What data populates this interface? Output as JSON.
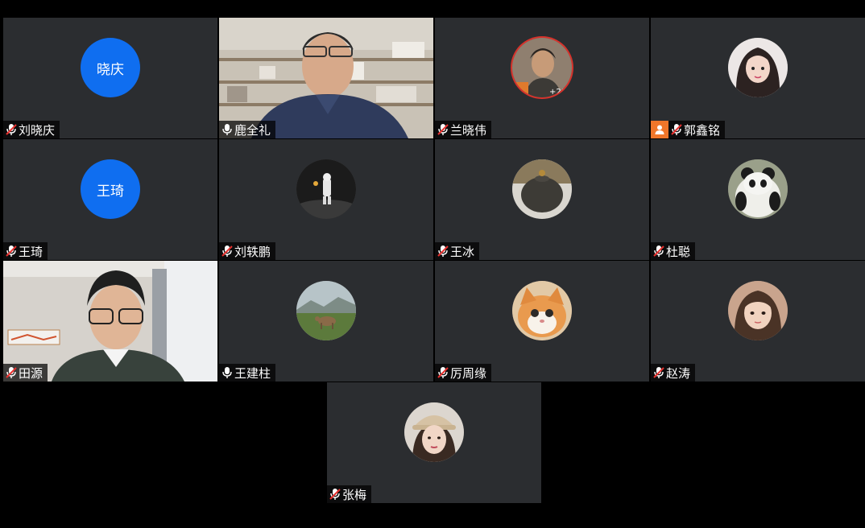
{
  "participants": [
    {
      "name": "刘晓庆",
      "avatar_text": "晓庆",
      "muted": true
    },
    {
      "name": "鹿全礼",
      "muted": false,
      "speaking": true,
      "video": true
    },
    {
      "name": "兰晓伟",
      "muted": true
    },
    {
      "name": "郭鑫铭",
      "muted": true,
      "host": true
    },
    {
      "name": "王琦",
      "avatar_text": "王琦",
      "muted": true
    },
    {
      "name": "刘轶鹏",
      "muted": true
    },
    {
      "name": "王冰",
      "muted": true
    },
    {
      "name": "杜聪",
      "muted": true
    },
    {
      "name": "田源",
      "muted": true,
      "video": true
    },
    {
      "name": "王建柱",
      "muted": false
    },
    {
      "name": "厉周缘",
      "muted": true
    },
    {
      "name": "赵涛",
      "muted": true
    },
    {
      "name": "张梅",
      "muted": true
    }
  ],
  "colors": {
    "tile_bg": "#2b2d30",
    "avatar_blue": "#0f6ef0",
    "speaking_border": "#3fd17a",
    "host_badge": "#f0762a",
    "muted_slash": "#e8312f"
  },
  "icons": {
    "muted": "mic-muted-icon",
    "unmuted": "mic-icon",
    "host": "host-person-icon"
  }
}
